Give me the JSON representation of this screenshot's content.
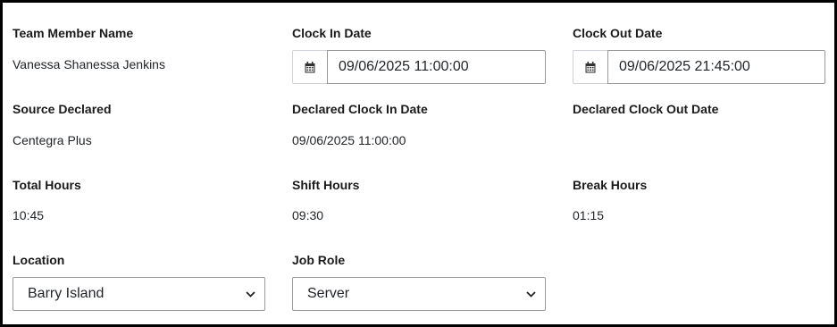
{
  "row1": {
    "team_member": {
      "label": "Team Member Name",
      "value": "Vanessa Shanessa Jenkins"
    },
    "clock_in": {
      "label": "Clock In Date",
      "value": "09/06/2025 11:00:00",
      "icon": "calendar-icon"
    },
    "clock_out": {
      "label": "Clock Out Date",
      "value": "09/06/2025 21:45:00",
      "icon": "calendar-icon"
    }
  },
  "row2": {
    "source": {
      "label": "Source Declared",
      "value": "Centegra Plus"
    },
    "declared_in": {
      "label": "Declared Clock In Date",
      "value": "09/06/2025 11:00:00"
    },
    "declared_out": {
      "label": "Declared Clock Out Date",
      "value": ""
    }
  },
  "row3": {
    "total_hours": {
      "label": "Total Hours",
      "value": "10:45"
    },
    "shift_hours": {
      "label": "Shift Hours",
      "value": "09:30"
    },
    "break_hours": {
      "label": "Break Hours",
      "value": "01:15"
    }
  },
  "row4": {
    "location": {
      "label": "Location",
      "selected": "Barry Island",
      "icon": "chevron-down-icon"
    },
    "job_role": {
      "label": "Job Role",
      "selected": "Server",
      "icon": "chevron-down-icon"
    }
  },
  "colors": {
    "frame_border": "#000000",
    "input_border": "#9a9a9a",
    "label_text": "#1a1a1a"
  }
}
